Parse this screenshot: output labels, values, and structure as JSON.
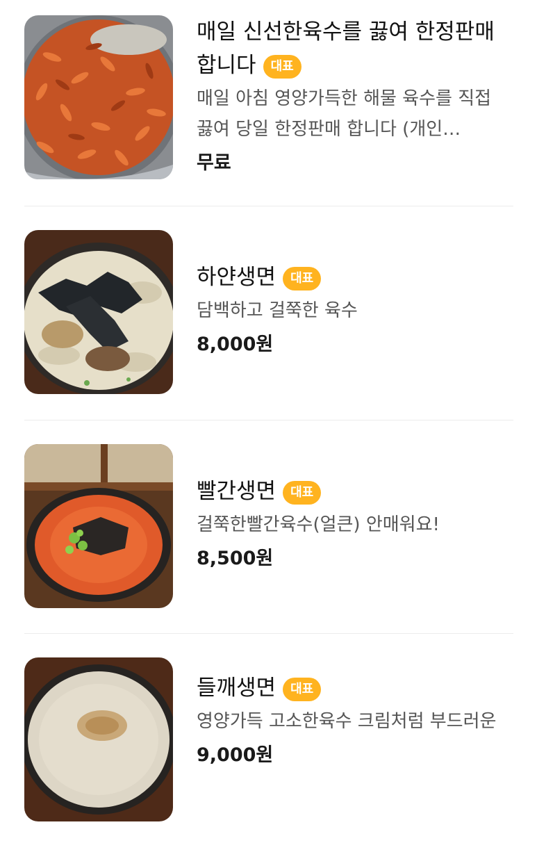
{
  "menu": {
    "items": [
      {
        "title": "매일 신선한육수를 끓여 한정판매 합니다",
        "badge": "대표",
        "description": "매일 아침 영양가득한 해물 육수를 직접 끓여 당일 한정판매 합니다 (개인…",
        "price": "무료",
        "image_icon": "shrimp-broth-photo"
      },
      {
        "title": "하얀생면",
        "badge": "대표",
        "description": "담백하고 걸쭉한 육수",
        "price": "8,000원",
        "image_icon": "white-noodle-photo"
      },
      {
        "title": "빨간생면",
        "badge": "대표",
        "description": "걸쭉한빨간육수(얼큰) 안매워요!",
        "price": "8,500원",
        "image_icon": "red-noodle-photo"
      },
      {
        "title": "들깨생면",
        "badge": "대표",
        "description": "영양가득 고소한육수 크림처럼 부드러운",
        "price": "9,000원",
        "image_icon": "perilla-noodle-photo"
      }
    ]
  },
  "colors": {
    "badge_bg": "#ffb31f",
    "divider": "#ececec",
    "description": "#555555"
  }
}
